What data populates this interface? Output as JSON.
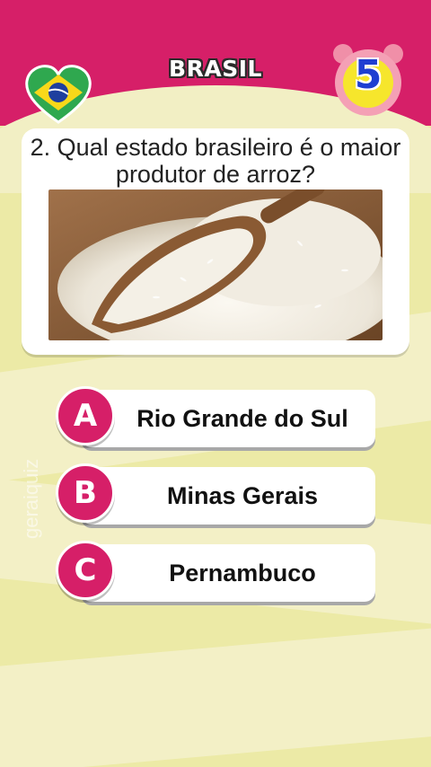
{
  "header": {
    "title": "BRASIL",
    "flag_icon": "brazil-flag-heart-icon",
    "timer_icon": "alarm-clock-icon",
    "timer_value": "5"
  },
  "question": {
    "text": "2. Qual estado brasileiro é o maior produtor de arroz?",
    "image": "rice-scoop-photo"
  },
  "answers": [
    {
      "letter": "A",
      "text": "Rio Grande do Sul"
    },
    {
      "letter": "B",
      "text": "Minas Gerais"
    },
    {
      "letter": "C",
      "text": "Pernambuco"
    }
  ],
  "watermark": "geraiquiz",
  "colors": {
    "accent": "#d61f68",
    "background": "#eceaa6",
    "timer_blue": "#1f3fd1",
    "timer_yellow": "#f6e62c"
  }
}
